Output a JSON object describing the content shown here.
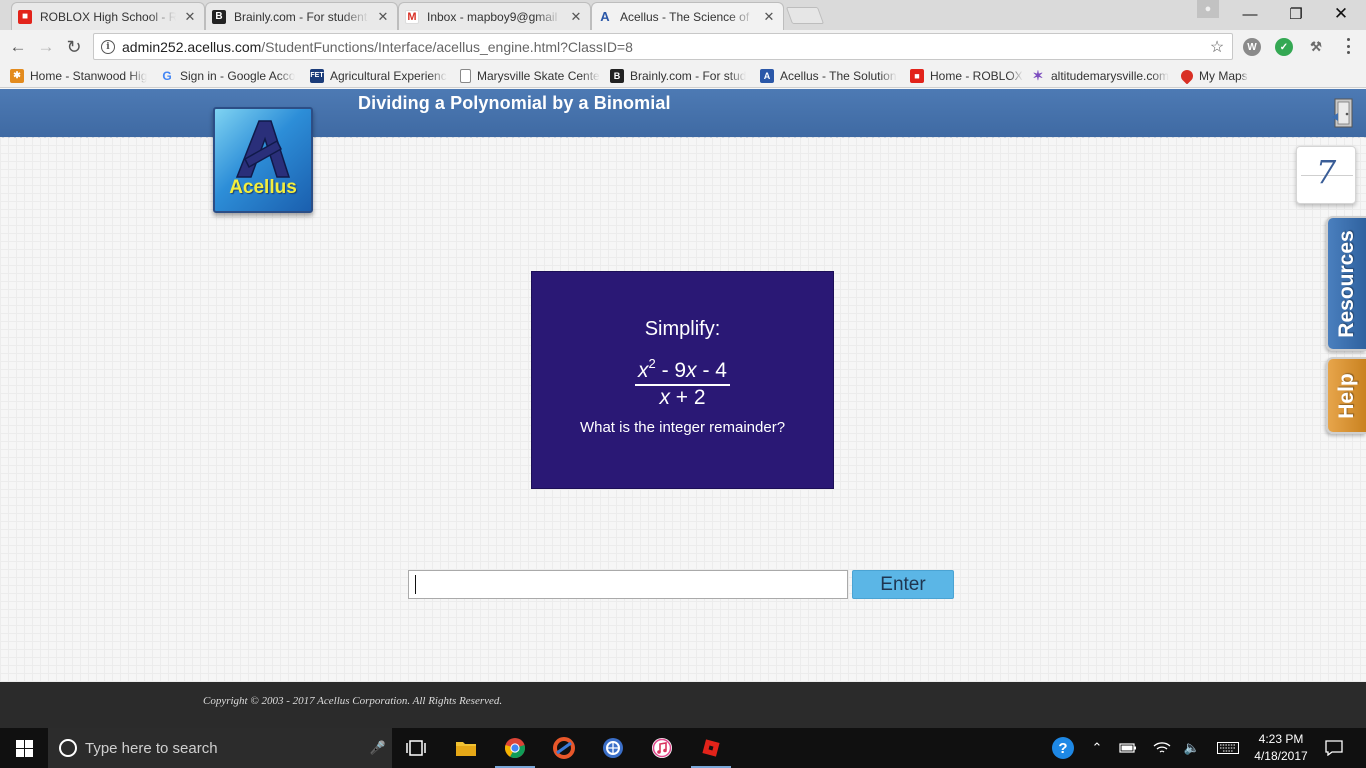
{
  "browser": {
    "tabs": [
      {
        "title": "ROBLOX High School - R",
        "favicon_color": "#e2231a",
        "favicon": "R"
      },
      {
        "title": "Brainly.com - For student",
        "favicon_color": "#222222",
        "favicon": "B"
      },
      {
        "title": "Inbox - mapboy9@gmail",
        "favicon_color": "#ffffff",
        "favicon": "M"
      },
      {
        "title": "Acellus - The Science of",
        "favicon_color": "#ffffff",
        "favicon": "A"
      }
    ],
    "url_host": "admin252.acellus.com",
    "url_path": "/StudentFunctions/Interface/acellus_engine.html?ClassID=8",
    "bookmarks": [
      {
        "label": "Home - Stanwood Hig",
        "color": "#e38b1e",
        "icon": "J"
      },
      {
        "label": "Sign in - Google Acco",
        "color": "#4285f4",
        "icon": "G"
      },
      {
        "label": "Agricultural Experienc",
        "color": "#1b3c7a",
        "icon": "FET"
      },
      {
        "label": "Marysville Skate Cente",
        "color": "#9a9a9a",
        "icon": "page"
      },
      {
        "label": "Brainly.com - For stud",
        "color": "#222222",
        "icon": "B"
      },
      {
        "label": "Acellus - The Solution",
        "color": "#2a57a8",
        "icon": "A"
      },
      {
        "label": "Home - ROBLOX",
        "color": "#e2231a",
        "icon": "R"
      },
      {
        "label": "altitudemarysville.com",
        "color": "#7c4dbf",
        "icon": "figure"
      },
      {
        "label": "My Maps",
        "color": "#d93025",
        "icon": "pin"
      }
    ]
  },
  "lesson": {
    "title": "Dividing a Polynomial by a Binomial",
    "logo_text": "Acellus",
    "counter": "7",
    "resources_label": "Resources",
    "help_label": "Help"
  },
  "problem": {
    "prompt": "Simplify:",
    "numerator": {
      "var1": "x",
      "exp": "2",
      "rest1": " - 9",
      "var2": "x",
      "rest2": " - 4"
    },
    "denominator": {
      "var": "x",
      "rest": " + 2"
    },
    "question": "What is the integer remainder?"
  },
  "answer": {
    "value": "",
    "placeholder": "",
    "enter_label": "Enter"
  },
  "footer": {
    "copyright": "Copyright © 2003 - 2017 Acellus Corporation.  All Rights Reserved."
  },
  "taskbar": {
    "search_placeholder": "Type here to search",
    "time": "4:23 PM",
    "date": "4/18/2017"
  },
  "colors": {
    "header_blue": "#4472ac",
    "card_purple": "#2a1875",
    "enter_blue": "#5bb6e6",
    "resources_blue": "#3a6eb0",
    "help_orange": "#d8912e"
  }
}
